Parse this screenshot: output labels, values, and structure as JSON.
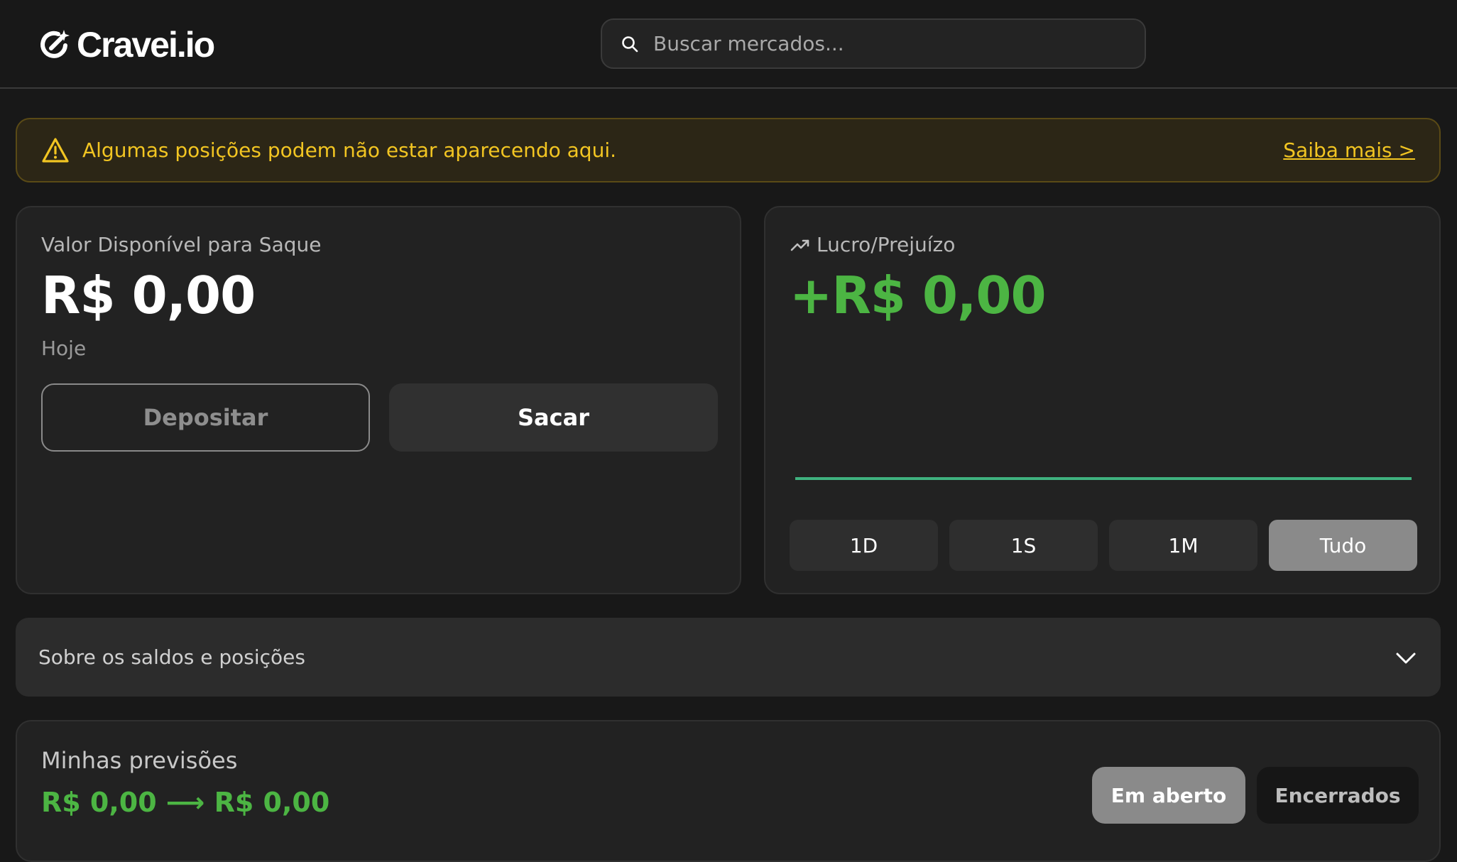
{
  "header": {
    "logo_text": "Cravei.io",
    "search_placeholder": "Buscar mercados..."
  },
  "alert": {
    "message": "Algumas posições podem não estar aparecendo aqui.",
    "link": "Saiba mais >"
  },
  "balance": {
    "label": "Valor Disponível para Saque",
    "value": "R$ 0,00",
    "sub": "Hoje",
    "deposit_label": "Depositar",
    "withdraw_label": "Sacar"
  },
  "pnl": {
    "label": "Lucro/Prejuízo",
    "value": "+R$ 0,00",
    "ranges": [
      "1D",
      "1S",
      "1M",
      "Tudo"
    ],
    "active_range": "Tudo",
    "line_color": "#3fb27f"
  },
  "accordion": {
    "label": "Sobre os saldos e posições"
  },
  "predictions": {
    "title": "Minhas previsões",
    "value": "R$ 0,00 ⟶ R$ 0,00",
    "tab_open": "Em aberto",
    "tab_closed": "Encerrados",
    "active_tab": "Em aberto"
  },
  "colors": {
    "accent_green": "#4cb543",
    "warning_yellow": "#f2c522",
    "background": "#181818"
  }
}
